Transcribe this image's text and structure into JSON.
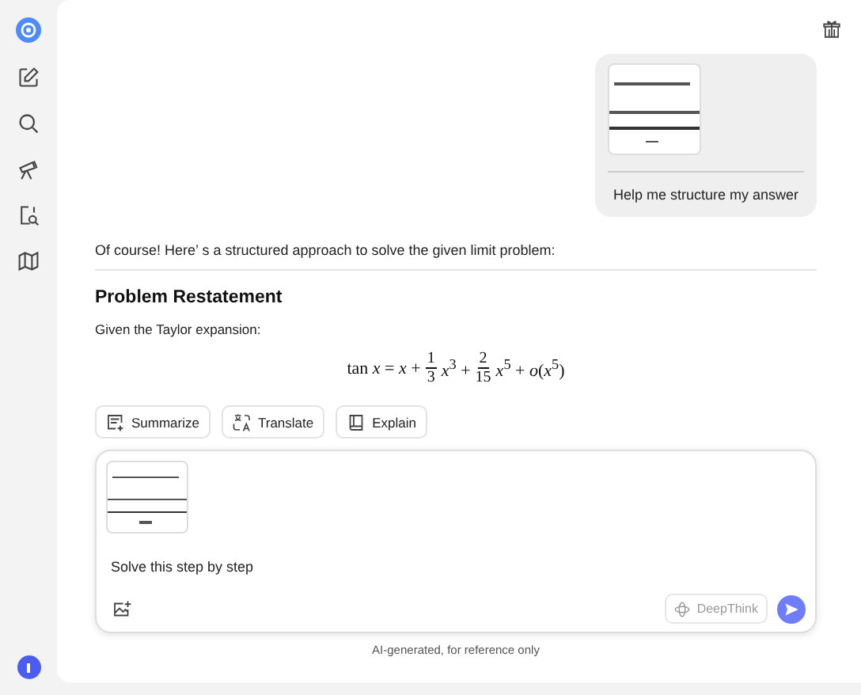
{
  "user_message": {
    "text": "Help me structure my answer"
  },
  "reply": {
    "intro": "Of course! Here’ s a structured approach to solve the given limit problem:",
    "heading": "Problem Restatement",
    "paragraph": "Given the Taylor expansion:",
    "formula": [
      {
        "kind": "text",
        "text": "tan *x* = *x* +"
      },
      {
        "kind": "frac",
        "num": "1",
        "den": "3"
      },
      {
        "kind": "text",
        "text": "*x*$^{3}$ +"
      },
      {
        "kind": "frac",
        "num": "2",
        "den": "15"
      },
      {
        "kind": "text",
        "text": "*x*$^{5}$ + *o*(*x*$^{5}$)"
      }
    ]
  },
  "actions": [
    {
      "kind": "summarize",
      "label": "Summarize"
    },
    {
      "kind": "translate",
      "label": "Translate"
    },
    {
      "kind": "explain",
      "label": "Explain"
    }
  ],
  "composer": {
    "value": "Solve this step by step",
    "deepthink": {
      "label": "DeepThink",
      "on": false
    }
  },
  "footer": "AI-generated, for reference only"
}
